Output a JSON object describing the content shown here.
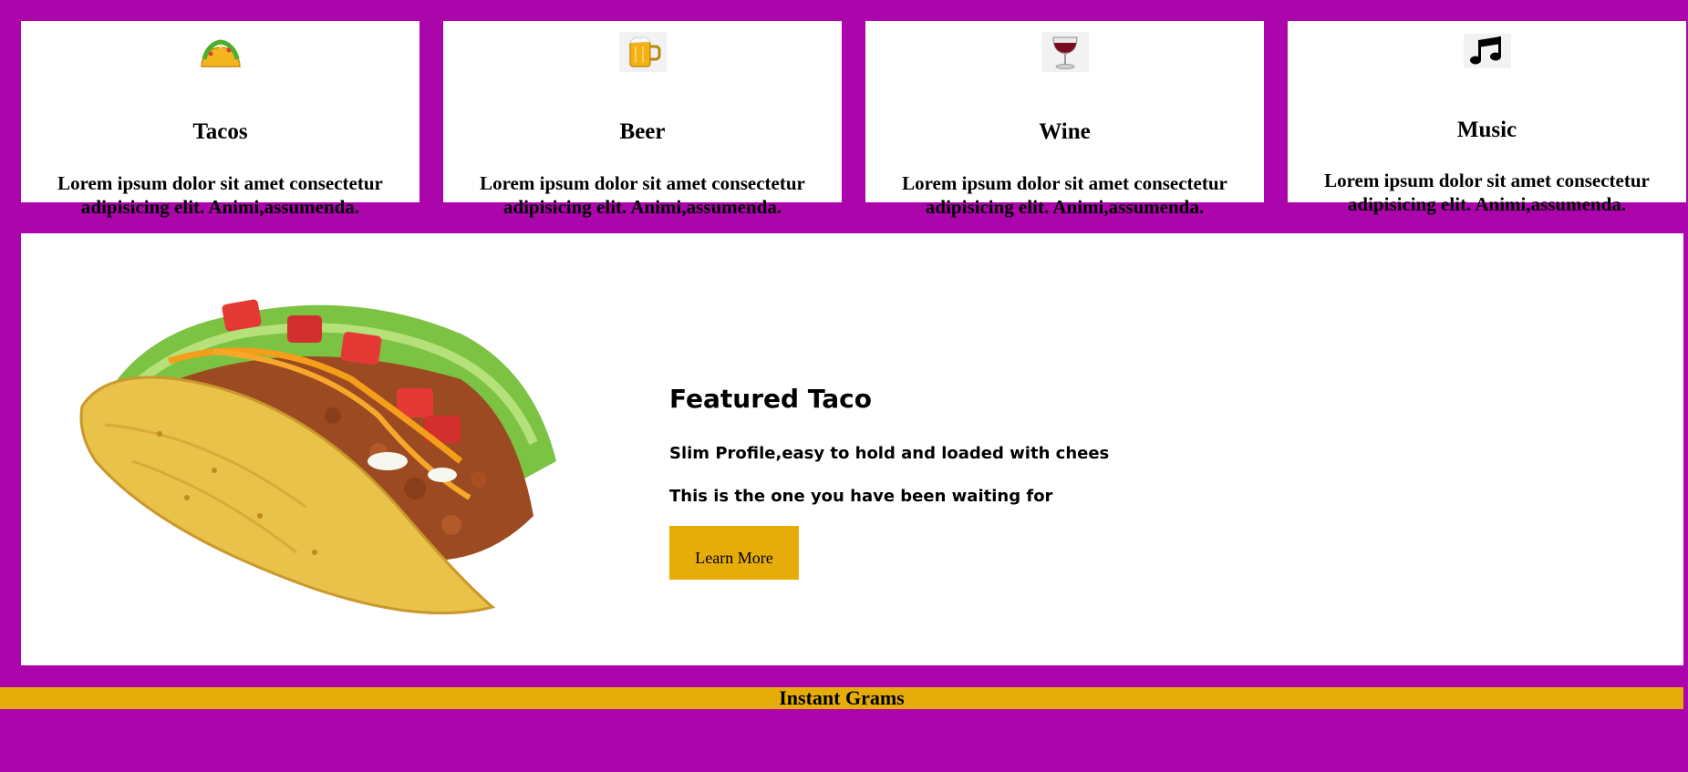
{
  "cards": [
    {
      "icon": "taco-icon",
      "title": "Tacos",
      "text": "Lorem ipsum dolor sit amet consectetur adipisicing elit. Animi,assumenda."
    },
    {
      "icon": "beer-mug-icon",
      "title": "Beer",
      "text": "Lorem ipsum dolor sit amet consectetur adipisicing elit. Animi,assumenda."
    },
    {
      "icon": "wine-glass-icon",
      "title": "Wine",
      "text": "Lorem ipsum dolor sit amet consectetur adipisicing elit. Animi,assumenda."
    },
    {
      "icon": "music-note-icon",
      "title": "Music",
      "text": "Lorem ipsum dolor sit amet consectetur adipisicing elit. Animi,assumenda."
    }
  ],
  "featured": {
    "image": "taco-photo",
    "title": "Featured Taco",
    "line1": "Slim Profile,easy to hold and loaded with chees",
    "line2": "This is the one you have been waiting for",
    "button_label": "Learn More"
  },
  "footer": {
    "text": "Instant Grams"
  },
  "colors": {
    "background": "#ab05ab",
    "accent": "#e6ac0a",
    "panel": "#ffffff"
  }
}
